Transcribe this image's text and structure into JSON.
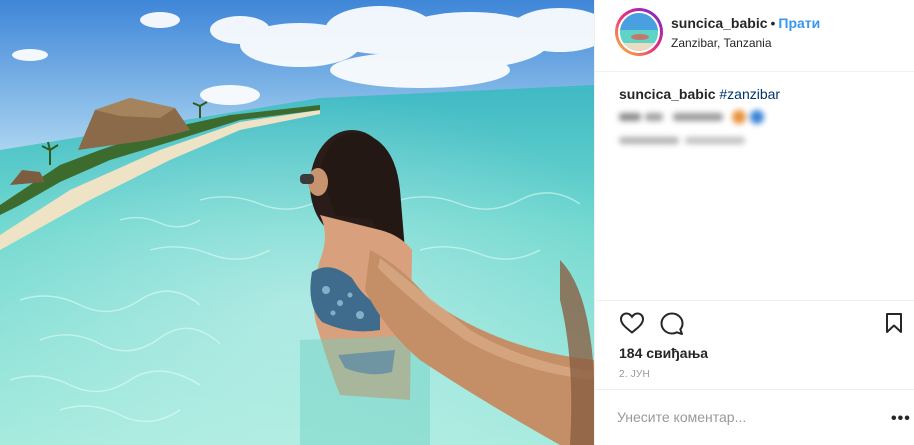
{
  "post": {
    "image_alt": "Woman in bikini standing in turquoise sea water near a thatched beach resort",
    "colors": {
      "sky": "#4f8fd6",
      "sea": "#5fcfc8",
      "sand": "#e9dcc0"
    }
  },
  "header": {
    "username": "suncica_babic",
    "separator": "•",
    "follow_label": "Прати",
    "location": "Zanzibar, Tanzania"
  },
  "caption": {
    "username": "suncica_babic",
    "hashtag": "#zanzibar"
  },
  "actions": {
    "like_icon": "heart-icon",
    "comment_icon": "comment-icon",
    "save_icon": "bookmark-icon"
  },
  "stats": {
    "likes": "184 свиђања",
    "date": "2. ЈУН"
  },
  "comment": {
    "placeholder": "Унесите коментар...",
    "more_icon": "•••"
  },
  "theme": {
    "link": "#3897f0",
    "hashtag": "#003569",
    "muted": "#999999",
    "border": "#efefef"
  }
}
